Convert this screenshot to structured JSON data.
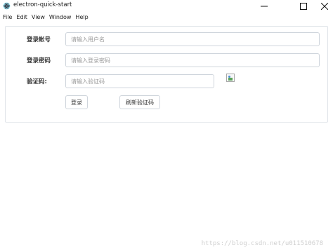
{
  "window": {
    "title": "electron-quick-start",
    "icons": {
      "app": "electron-atom-icon",
      "minimize": "minimize-icon",
      "maximize": "maximize-icon",
      "close": "close-icon"
    }
  },
  "menubar": {
    "items": [
      "File",
      "Edit",
      "View",
      "Window",
      "Help"
    ]
  },
  "form": {
    "username": {
      "label": "登录帐号",
      "placeholder": "请输入用户名",
      "value": ""
    },
    "password": {
      "label": "登录密码",
      "placeholder": "请输入登录密码",
      "value": ""
    },
    "captcha": {
      "label": "验证码:",
      "placeholder": "请输入验证码",
      "value": ""
    },
    "captcha_image": "broken-image-icon",
    "login_button": "登录",
    "refresh_button": "刷新验证码"
  },
  "watermark": "https://blog.csdn.net/u011510678",
  "colors": {
    "border": "#dfe3e8",
    "input_border": "#cfd5dc",
    "placeholder": "#9a9a9a",
    "watermark": "#cfcfcf"
  }
}
